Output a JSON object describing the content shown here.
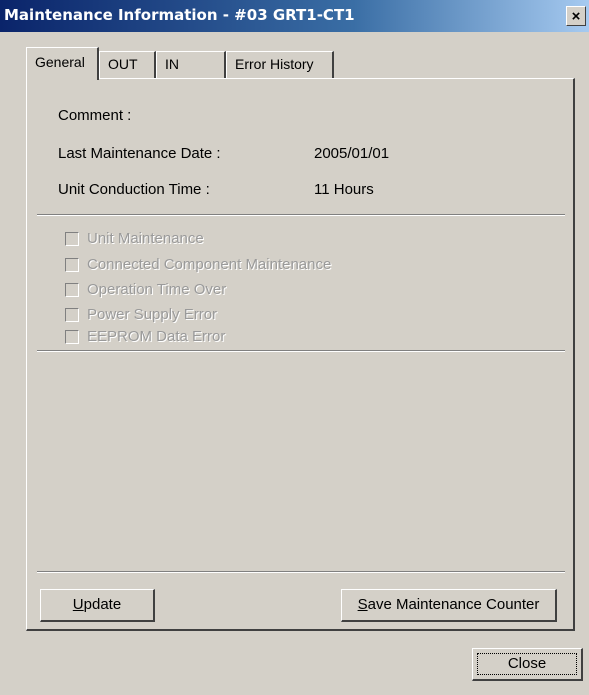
{
  "window": {
    "title": "Maintenance Information - #03 GRT1-CT1",
    "close_glyph": "×"
  },
  "tabs": [
    {
      "label": "General",
      "active": true
    },
    {
      "label": "OUT",
      "active": false
    },
    {
      "label": "IN",
      "active": false
    },
    {
      "label": "Error History",
      "active": false
    }
  ],
  "general": {
    "comment_label": "Comment :",
    "last_maintenance_label": "Last Maintenance Date :",
    "last_maintenance_value": "2005/01/01",
    "conduction_time_label": "Unit Conduction Time :",
    "conduction_time_value": "11 Hours"
  },
  "checkboxes": [
    {
      "label": "Unit Maintenance",
      "checked": false,
      "enabled": false
    },
    {
      "label": "Connected Component Maintenance",
      "checked": false,
      "enabled": false
    },
    {
      "label": "Operation Time Over",
      "checked": false,
      "enabled": false
    },
    {
      "label": "Power Supply Error",
      "checked": false,
      "enabled": false
    },
    {
      "label": "EEPROM Data Error",
      "checked": false,
      "enabled": false
    }
  ],
  "buttons": {
    "update_mnemonic": "U",
    "update_rest": "pdate",
    "save_mnemonic": "S",
    "save_rest": "ave Maintenance Counter",
    "close": "Close"
  }
}
